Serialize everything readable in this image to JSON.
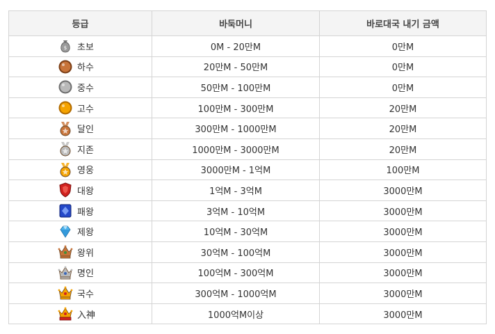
{
  "headers": [
    "등급",
    "바둑머니",
    "바로대국 내기 금액"
  ],
  "rows": [
    {
      "icon": "money-bag-icon",
      "grade": "초보",
      "money": "0M  - 20만M",
      "bet": "0만M"
    },
    {
      "icon": "bronze-coin-icon",
      "grade": "하수",
      "money": "20만M  - 50만M",
      "bet": "0만M"
    },
    {
      "icon": "silver-coin-icon",
      "grade": "중수",
      "money": "50만M  - 100만M",
      "bet": "0만M"
    },
    {
      "icon": "gold-coin-icon",
      "grade": "고수",
      "money": "100만M  - 300만M",
      "bet": "20만M"
    },
    {
      "icon": "bronze-medal-icon",
      "grade": "달인",
      "money": "300만M  - 1000만M",
      "bet": "20만M"
    },
    {
      "icon": "silver-medal-icon",
      "grade": "지존",
      "money": "1000만M  - 3000만M",
      "bet": "20만M"
    },
    {
      "icon": "gold-medal-icon",
      "grade": "영웅",
      "money": "3000만M  - 1억M",
      "bet": "100만M"
    },
    {
      "icon": "red-shield-icon",
      "grade": "대왕",
      "money": "1억M - 3억M",
      "bet": "3000만M"
    },
    {
      "icon": "blue-gem-icon",
      "grade": "패왕",
      "money": "3억M - 10억M",
      "bet": "3000만M"
    },
    {
      "icon": "diamond-icon",
      "grade": "제왕",
      "money": "10억M - 30억M",
      "bet": "3000만M"
    },
    {
      "icon": "bronze-crown-icon",
      "grade": "왕위",
      "money": "30억M - 100억M",
      "bet": "3000만M"
    },
    {
      "icon": "silver-crown-icon",
      "grade": "명인",
      "money": "100억M - 300억M",
      "bet": "3000만M"
    },
    {
      "icon": "gold-crown-icon",
      "grade": "국수",
      "money": "300억M - 1000억M",
      "bet": "3000만M"
    },
    {
      "icon": "red-gold-crown-icon",
      "grade": "入神",
      "money": "1000억M이상",
      "bet": "3000만M"
    }
  ],
  "icon_colors": {
    "money_bag": "#9a9a9a",
    "bronze": "#c8743a",
    "silver": "#b9b9b9",
    "gold": "#f5a300",
    "red": "#d0221f",
    "blue": "#2448c8",
    "diamond": "#4fb6f0"
  }
}
